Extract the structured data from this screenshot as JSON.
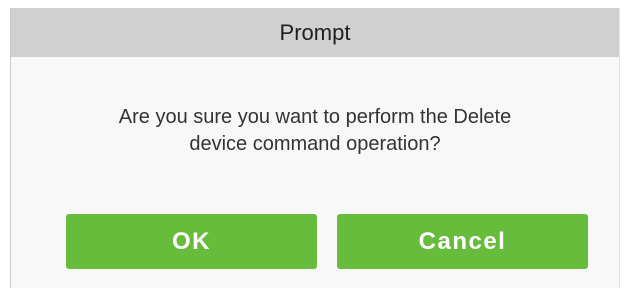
{
  "dialog": {
    "title": "Prompt",
    "message_lines": [
      "Are you sure you want to perform the Delete",
      "device command operation?"
    ],
    "ok_label": "OK",
    "cancel_label": "Cancel"
  },
  "colors": {
    "titlebar_bg": "#d0d0d0",
    "button_green": "#67bc3b",
    "button_text": "#ffffff"
  }
}
